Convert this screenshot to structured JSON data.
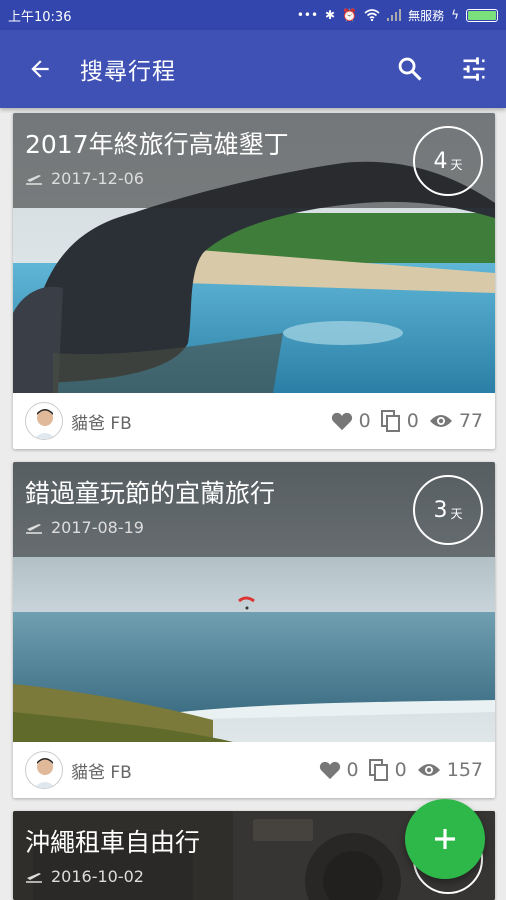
{
  "status_bar": {
    "time": "上午10:36",
    "carrier": "無服務",
    "icons": [
      "bluetooth-icon",
      "alarm-icon",
      "wifi-icon",
      "signal-icon",
      "charging-icon",
      "battery-icon"
    ]
  },
  "app_bar": {
    "title": "搜尋行程",
    "icons": [
      "back-arrow-icon",
      "search-icon",
      "filter-sliders-icon"
    ]
  },
  "trips": [
    {
      "title": "2017年終旅行高雄墾丁",
      "date": "2017-12-06",
      "days": "4",
      "days_unit": "天",
      "author": "貓爸 FB",
      "likes": "0",
      "copies": "0",
      "views": "77"
    },
    {
      "title": "錯過童玩節的宜蘭旅行",
      "date": "2017-08-19",
      "days": "3",
      "days_unit": "天",
      "author": "貓爸 FB",
      "likes": "0",
      "copies": "0",
      "views": "157"
    },
    {
      "title": "沖繩租車自由行",
      "date": "2016-10-02"
    }
  ],
  "fab": {
    "icon": "plus-icon",
    "color": "#2eb84a"
  },
  "colors": {
    "primary": "#3f51b5",
    "status_bar": "#3346ae",
    "accent": "#2eb84a"
  }
}
